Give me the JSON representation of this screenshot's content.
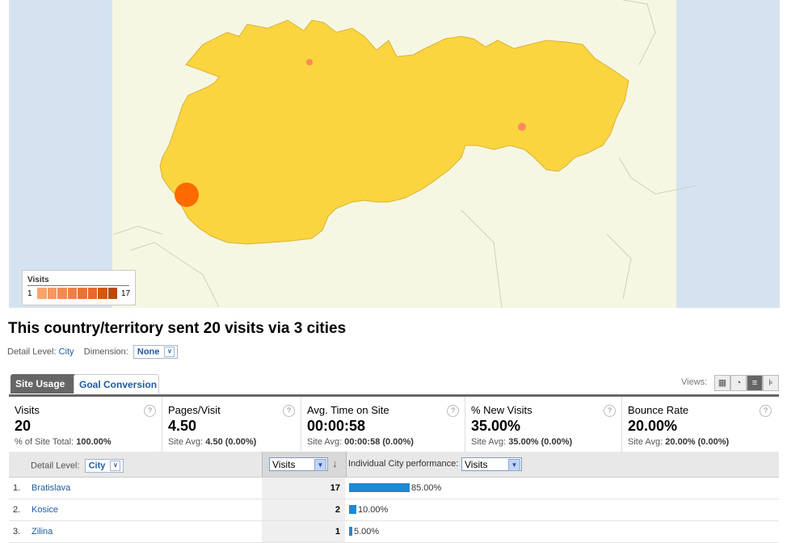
{
  "map": {
    "legend_title": "Visits",
    "legend_min": "1",
    "legend_max": "17",
    "legend_colors": [
      "#f7a36b",
      "#f49760",
      "#f28b52",
      "#ef7f46",
      "#ea7338",
      "#e6692c",
      "#d45712",
      "#b84a0c"
    ],
    "country_fill": "#fbd540",
    "country_stroke": "#d9b23a",
    "water_color": "#d5e3f1",
    "land_color": "#f6f7e2",
    "markers": [
      {
        "city": "Bratislava",
        "visits": 17,
        "color": "#fd6a00"
      },
      {
        "city": "Kosice",
        "visits": 2,
        "color": "#fd8a5a"
      },
      {
        "city": "Zilina",
        "visits": 1,
        "color": "#fd8a5a"
      }
    ]
  },
  "headline": "This country/territory sent 20 visits via 3 cities",
  "detail_level_label": "Detail Level:",
  "detail_level_value": "City",
  "dimension_label": "Dimension:",
  "dimension_value": "None",
  "tabs": [
    {
      "label": "Site Usage",
      "active": true
    },
    {
      "label": "Goal Conversion",
      "active": false
    }
  ],
  "views_label": "Views:",
  "view_icons": [
    "table-view-icon",
    "pie-view-icon",
    "performance-view-icon",
    "comparison-view-icon"
  ],
  "scorecard": [
    {
      "name": "Visits",
      "value": "20",
      "cmp_label": "% of Site Total:",
      "cmp_value": "100.00%"
    },
    {
      "name": "Pages/Visit",
      "value": "4.50",
      "cmp_label": "Site Avg:",
      "cmp_value": "4.50 (0.00%)"
    },
    {
      "name": "Avg. Time on Site",
      "value": "00:00:58",
      "cmp_label": "Site Avg:",
      "cmp_value": "00:00:58 (0.00%)"
    },
    {
      "name": "% New Visits",
      "value": "35.00%",
      "cmp_label": "Site Avg:",
      "cmp_value": "35.00% (0.00%)"
    },
    {
      "name": "Bounce Rate",
      "value": "20.00%",
      "cmp_label": "Site Avg:",
      "cmp_value": "20.00% (0.00%)"
    }
  ],
  "table": {
    "detail_label": "Detail Level:",
    "detail_value": "City",
    "metric_select": "Visits",
    "perf_label": "Individual City performance:",
    "perf_select": "Visits",
    "rows": [
      {
        "num": "1.",
        "city": "Bratislava",
        "visits": "17",
        "pct": "85.00%",
        "share": 85
      },
      {
        "num": "2.",
        "city": "Kosice",
        "visits": "2",
        "pct": "10.00%",
        "share": 10
      },
      {
        "num": "3.",
        "city": "Zilina",
        "visits": "1",
        "pct": "5.00%",
        "share": 5
      }
    ]
  },
  "help_glyph": "?",
  "sort_glyph": "↓",
  "dropdown_glyph": "∨",
  "select_glyph": "▼"
}
